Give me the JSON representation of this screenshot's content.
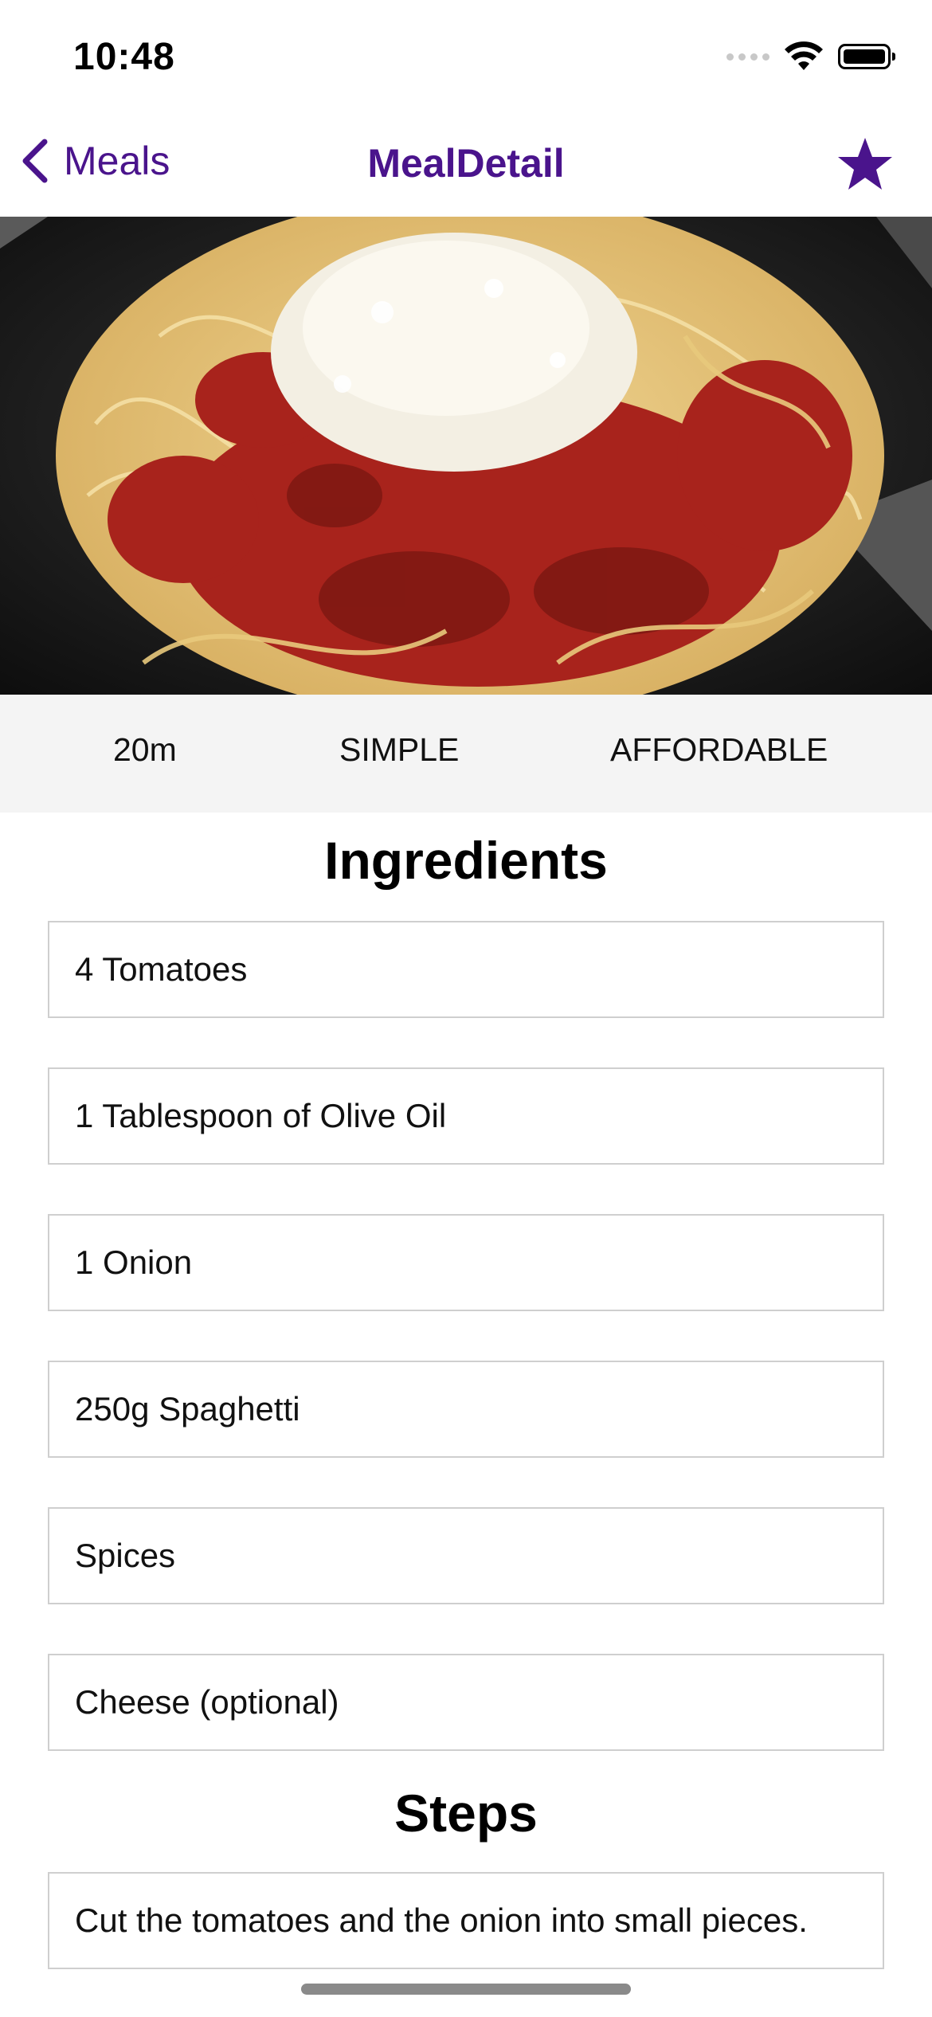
{
  "status_bar": {
    "time": "10:48"
  },
  "nav": {
    "back_label": "Meals",
    "title": "MealDetail"
  },
  "meal": {
    "duration": "20m",
    "complexity": "SIMPLE",
    "affordability": "AFFORDABLE"
  },
  "ingredients": {
    "title": "Ingredients",
    "items": [
      "4 Tomatoes",
      "1 Tablespoon of Olive Oil",
      "1 Onion",
      "250g Spaghetti",
      "Spices",
      "Cheese (optional)"
    ]
  },
  "steps": {
    "title": "Steps",
    "items": [
      "Cut the tomatoes and the onion into small pieces."
    ]
  },
  "colors": {
    "accent": "#4a148c",
    "meta_background": "#f4f4f4",
    "item_border": "#cfcfcf"
  },
  "icons": {
    "back": "chevron-left-icon",
    "favorite": "star-icon",
    "wifi": "wifi-icon",
    "battery": "battery-icon"
  }
}
